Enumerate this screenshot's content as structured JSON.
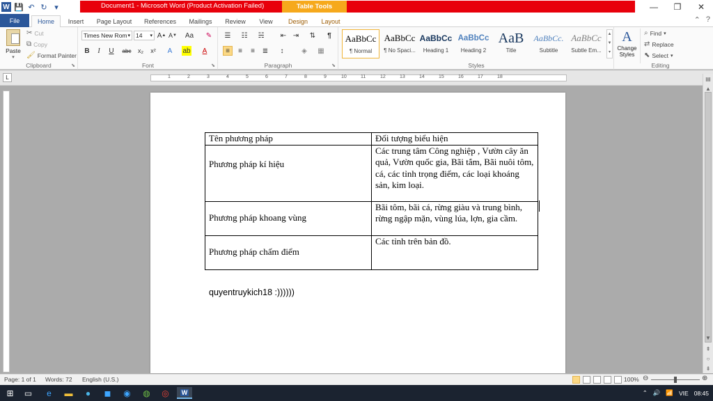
{
  "window": {
    "title": "Document1  -  Microsoft Word (Product Activation Failed)",
    "context_tab": "Table Tools",
    "minimize_glyph": "—",
    "restore_glyph": "❐",
    "close_glyph": "✕"
  },
  "qat": {
    "save_glyph": "💾",
    "undo_glyph": "↶",
    "redo_glyph": "↻",
    "customize_glyph": "▾"
  },
  "tabs": [
    "File",
    "Home",
    "Insert",
    "Page Layout",
    "References",
    "Mailings",
    "Review",
    "View",
    "Design",
    "Layout"
  ],
  "ribbon": {
    "clipboard": {
      "label": "Clipboard",
      "paste": "Paste",
      "cut": "Cut",
      "copy": "Copy",
      "format_painter": "Format Painter"
    },
    "font": {
      "label": "Font",
      "font_name": "Times New Rom",
      "font_size": "14"
    },
    "paragraph": {
      "label": "Paragraph"
    },
    "styles": {
      "label": "Styles",
      "items": [
        {
          "sample": "AaBbCc",
          "name": "¶ Normal"
        },
        {
          "sample": "AaBbCc",
          "name": "¶ No Spaci..."
        },
        {
          "sample": "AaBbCc",
          "name": "Heading 1"
        },
        {
          "sample": "AaBbCc",
          "name": "Heading 2"
        },
        {
          "sample": "AaB",
          "name": "Title"
        },
        {
          "sample": "AaBbCc.",
          "name": "Subtitle"
        },
        {
          "sample": "AaBbCc",
          "name": "Subtle Em..."
        }
      ],
      "change_styles": "Change Styles"
    },
    "editing": {
      "label": "Editing",
      "find": "Find",
      "replace": "Replace",
      "select": "Select"
    }
  },
  "document": {
    "table": {
      "headers": [
        "Tên phương pháp",
        "Đối tượng biểu hiện"
      ],
      "rows": [
        [
          "Phương pháp kí hiệu",
          "Các trung tâm Công nghiệp , Vườn cây ăn quả, Vườn quốc gia, Bãi tắm, Bãi nuôi tôm, cá, các tỉnh trọng điểm, các loại khoáng sản, kim loại."
        ],
        [
          "Phương pháp khoang vùng",
          "Bãi tôm, bãi cá, rừng giàu và trung bình, rừng ngập mặn, vùng lúa, lợn, gia cầm."
        ],
        [
          "Phương pháp chấm điểm",
          "Các tỉnh trên bản đồ."
        ]
      ]
    },
    "signature": "quyentruykich18 :))))))"
  },
  "status": {
    "page": "Page: 1 of 1",
    "words": "Words: 72",
    "language": "English (U.S.)",
    "zoom": "100%"
  },
  "tray": {
    "lang": "VIE",
    "time": "08:45"
  }
}
